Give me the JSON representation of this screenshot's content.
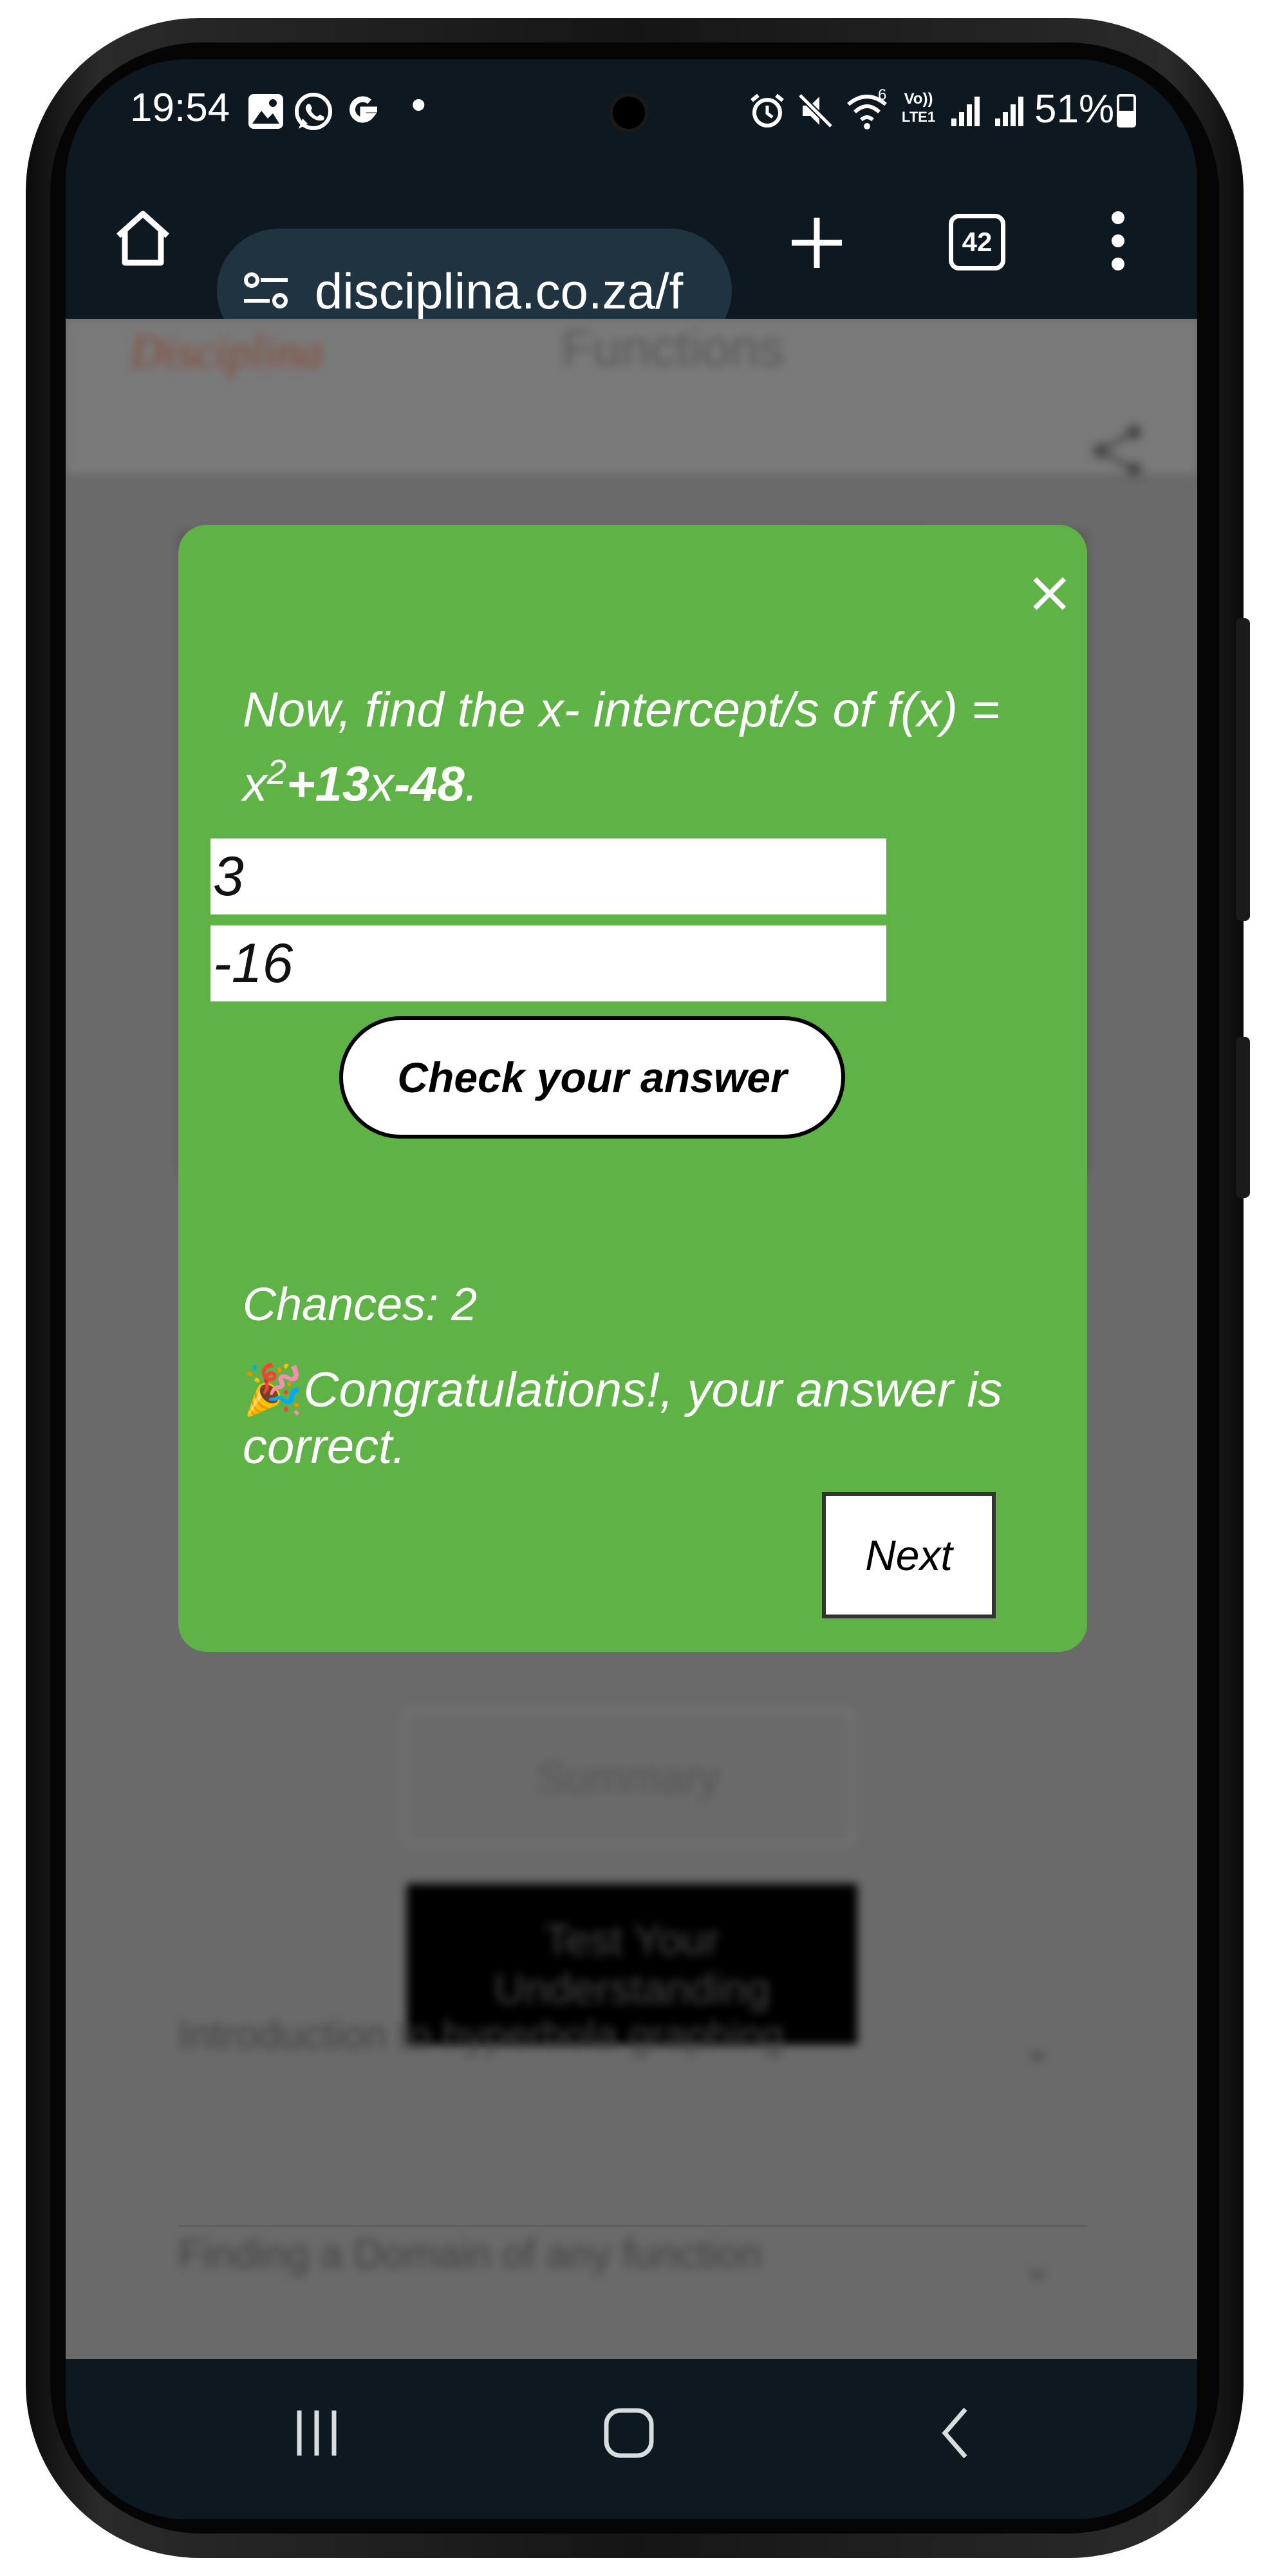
{
  "status_bar": {
    "time": "19:54",
    "notification_icons": [
      "gallery-icon",
      "whatsapp-icon",
      "google-icon"
    ],
    "dot": "•",
    "system_icons": [
      "alarm-icon",
      "mute-icon",
      "wifi-icon",
      "lte-icon",
      "signal-icon",
      "signal-icon",
      "battery-icon"
    ],
    "network_top": "Vo))",
    "network_bottom": "LTE1",
    "wifi_label": "6",
    "battery_percent": "51%",
    "battery_level": 0.51
  },
  "browser": {
    "url": "disciplina.co.za/f",
    "tabs_count": "42",
    "icons": [
      "home-icon",
      "site-settings-icon",
      "plus-icon",
      "tabs-icon",
      "more-vert-icon"
    ]
  },
  "page_background": {
    "logo": "Disciplina",
    "title": "Functions",
    "summary_button": "Summary",
    "test_button": "Test Your Understanding",
    "accordion": [
      "Introduction to hyperbola graphing",
      "Finding a Domain of any function"
    ]
  },
  "modal": {
    "close_symbol": "×",
    "question_prefix": "Now, find the x- intercept/s of f(x) = x",
    "exponent": "2",
    "coef_b": "+13",
    "var_x": "x",
    "const_c": "-48",
    "period": ".",
    "answer1": "3",
    "answer2": "-16",
    "check_label": "Check your answer",
    "chances": "Chances: 2",
    "emoji": "🎉",
    "congrats": "Congratulations!, your answer is correct.",
    "next_label": "Next"
  },
  "colors": {
    "modal_green": "#5fb246",
    "overlay_gray": "#6a6a6a",
    "system_bar": "#0d1820"
  }
}
